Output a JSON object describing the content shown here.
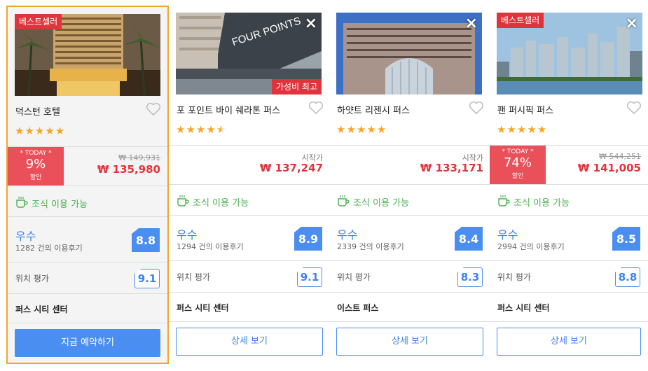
{
  "hotels": [
    {
      "badge_top": "베스트셀러",
      "badge_bottom": "",
      "closable": false,
      "name": "덕스턴 호텔",
      "stars": 5,
      "today_label": "* TODAY *",
      "discount": "9%",
      "discount_word": "할인",
      "original_price": "₩ 149,931",
      "from_label": "",
      "price": "₩ 135,980",
      "breakfast": "조식 이용 가능",
      "rating_word": "우수",
      "reviews": "1282 건의 이용후기",
      "score": "8.8",
      "location_label": "위치 평가",
      "location_score": "9.1",
      "area": "퍼스 시티 센터",
      "button": "지금 예약하기",
      "image_icon": "hotel-tower-palms-photo"
    },
    {
      "badge_top": "",
      "badge_bottom": "가성비 최고",
      "closable": true,
      "name": "포 포인트 바이 쉐라톤 퍼스",
      "stars": 4.5,
      "today_label": "",
      "discount": "",
      "discount_word": "",
      "original_price": "",
      "from_label": "시작가",
      "price": "₩ 137,247",
      "breakfast": "조식 이용 가능",
      "rating_word": "우수",
      "reviews": "1294 건의 이용후기",
      "score": "8.9",
      "location_label": "위치 평가",
      "location_score": "9.1",
      "area": "퍼스 시티 센터",
      "button": "상세 보기",
      "image_icon": "four-points-facade-photo",
      "image_sign": "FOUR POINTS"
    },
    {
      "badge_top": "",
      "badge_bottom": "",
      "closable": true,
      "name": "하얏트 리젠시 퍼스",
      "stars": 5,
      "today_label": "",
      "discount": "",
      "discount_word": "",
      "original_price": "",
      "from_label": "시작가",
      "price": "₩ 133,171",
      "breakfast": "조식 이용 가능",
      "rating_word": "우수",
      "reviews": "2339 건의 이용후기",
      "score": "8.4",
      "location_label": "위치 평가",
      "location_score": "8.3",
      "area": "이스트 퍼스",
      "button": "상세 보기",
      "image_icon": "hyatt-building-photo"
    },
    {
      "badge_top": "베스트셀러",
      "badge_bottom": "",
      "closable": true,
      "name": "팬 퍼시픽 퍼스",
      "stars": 5,
      "today_label": "* TODAY *",
      "discount": "74%",
      "discount_word": "할인",
      "original_price": "₩ 544,251",
      "from_label": "",
      "price": "₩ 141,005",
      "breakfast": "조식 이용 가능",
      "rating_word": "우수",
      "reviews": "2994 건의 이용후기",
      "score": "8.5",
      "location_label": "위치 평가",
      "location_score": "8.8",
      "area": "퍼스 시티 센터",
      "button": "상세 보기",
      "image_icon": "city-skyline-photo"
    }
  ],
  "icons": {
    "close": "×",
    "heart": "heart-outline-icon",
    "star": "★",
    "breakfast": "coffee-cup-icon"
  },
  "colors": {
    "accent": "#4b8ef1",
    "badge": "#e0343c",
    "today": "#e9505a",
    "star": "#f5a623",
    "breakfast": "#4caf50",
    "selected_border": "#f5a623"
  }
}
